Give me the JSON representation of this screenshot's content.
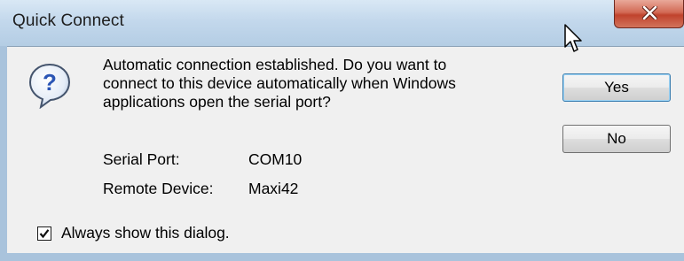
{
  "window": {
    "title": "Quick Connect"
  },
  "dialog": {
    "message_lines": [
      "Automatic connection established.  Do you want to",
      "connect to this device automatically when Windows",
      "applications open the serial port?"
    ],
    "serial_port_label": "Serial Port:",
    "serial_port_value": "COM10",
    "remote_device_label": "Remote Device:",
    "remote_device_value": "Maxi42",
    "checkbox_label": "Always show this dialog.",
    "checkbox_checked": true
  },
  "buttons": {
    "yes_label": "Yes",
    "no_label": "No"
  },
  "icons": {
    "dialog_icon": "question-icon",
    "close_icon": "close-icon",
    "cursor": "mouse-cursor-icon"
  },
  "colors": {
    "close_button": "#c0432d",
    "question_icon": "#2a55b5",
    "titlebar": "#c3d8ec"
  }
}
